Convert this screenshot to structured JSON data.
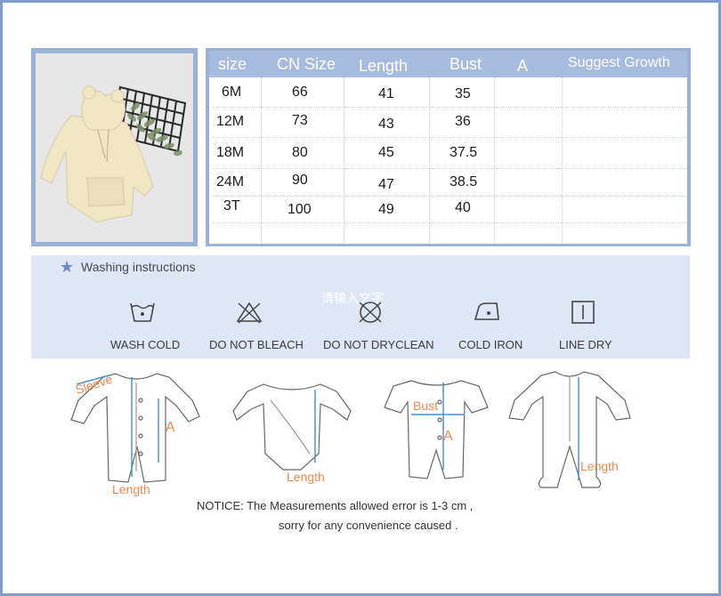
{
  "table": {
    "headers": [
      "size",
      "CN Size",
      "Length",
      "Bust",
      "A",
      "Suggest Growth"
    ],
    "rows": [
      [
        "6M",
        "66",
        "41",
        "35",
        "",
        ""
      ],
      [
        "12M",
        "73",
        "43",
        "36",
        "",
        ""
      ],
      [
        "18M",
        "80",
        "45",
        "37.5",
        "",
        ""
      ],
      [
        "24M",
        "90",
        "47",
        "38.5",
        "",
        ""
      ],
      [
        "3T",
        "100",
        "49",
        "40",
        "",
        ""
      ]
    ]
  },
  "washing": {
    "title": "Washing instructions",
    "overlay_text": "请输入文字",
    "items": [
      {
        "label": "WASH COLD",
        "icon": "wash-cold-icon"
      },
      {
        "label": "DO NOT BLEACH",
        "icon": "no-bleach-icon"
      },
      {
        "label": "DO NOT DRYCLEAN",
        "icon": "no-dryclean-icon"
      },
      {
        "label": "COLD IRON",
        "icon": "cold-iron-icon"
      },
      {
        "label": "LINE DRY",
        "icon": "line-dry-icon"
      }
    ]
  },
  "measure_labels": {
    "sleeve": "Sleeve",
    "a": "A",
    "length": "Length",
    "bust": "Bust"
  },
  "notice": {
    "line1": "NOTICE:   The Measurements allowed error is 1-3 cm ,",
    "line2": "sorry for any convenience caused ."
  },
  "colors": {
    "frame": "#7f9bc9",
    "header": "#a6bcde",
    "measure": "#e8894d",
    "measure_line": "#4f8fd6"
  }
}
